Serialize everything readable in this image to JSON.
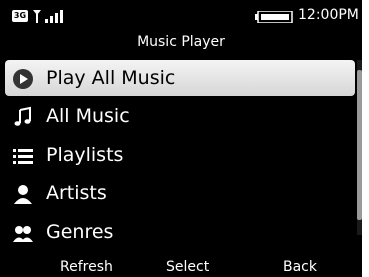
{
  "status": {
    "network": "3G",
    "time": "12:00PM"
  },
  "app": {
    "title": "Music Player"
  },
  "menu": {
    "items": [
      {
        "label": "Play All Music",
        "icon": "play-icon",
        "selected": true
      },
      {
        "label": "All Music",
        "icon": "music-note-icon",
        "selected": false
      },
      {
        "label": "Playlists",
        "icon": "list-icon",
        "selected": false
      },
      {
        "label": "Artists",
        "icon": "person-icon",
        "selected": false
      },
      {
        "label": "Genres",
        "icon": "genres-icon",
        "selected": false
      }
    ]
  },
  "softkeys": {
    "left": "Refresh",
    "center": "Select",
    "right": "Back"
  },
  "colors": {
    "background": "#000000",
    "text": "#ffffff",
    "selection": "#e6e6e6"
  }
}
